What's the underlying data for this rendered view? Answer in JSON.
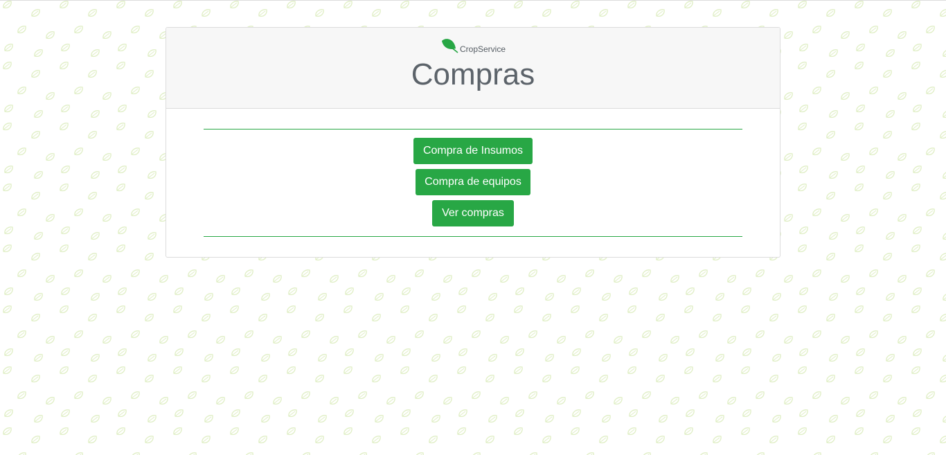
{
  "app": {
    "brand_name": "CropService",
    "logo_icon": "leaf-icon",
    "background_icon": "leaf-icon"
  },
  "page": {
    "title": "Compras"
  },
  "actions": {
    "compra_insumos_label": "Compra de Insumos",
    "compra_equipos_label": "Compra de equipos",
    "ver_compras_label": "Ver compras"
  },
  "colors": {
    "accent": "#28a745",
    "pattern_leaf": "#dfeec4",
    "title_text": "#5c636a",
    "header_bg": "#f7f7f7"
  }
}
